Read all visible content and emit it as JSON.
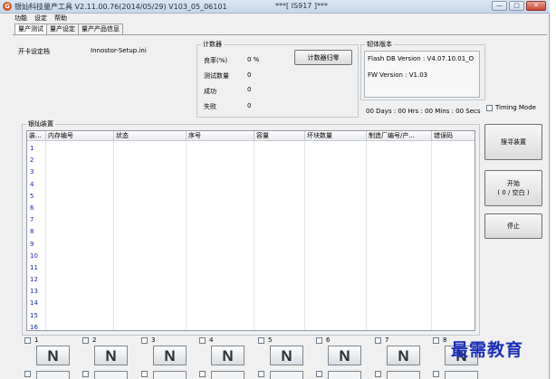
{
  "window": {
    "title": "银灿科技量产工具 V2.11.00.76(2014/05/29)    V103_05_06101",
    "title_mid": "***[ IS917 ]***",
    "icon_name": "app-logo-icon",
    "buttons": [
      "minimize",
      "maximize",
      "close"
    ]
  },
  "menu": [
    "功能",
    "设定",
    "帮助"
  ],
  "tabs": [
    "量产测试",
    "量产设定",
    "量产产品信息"
  ],
  "open_card": {
    "label": "开卡设定档",
    "value": "Innostor-Setup.ini"
  },
  "counter": {
    "legend": "计数器",
    "rows": [
      {
        "label": "良率(%)",
        "value": "0 %"
      },
      {
        "label": "测试数量",
        "value": "0"
      },
      {
        "label": "成功",
        "value": "0"
      },
      {
        "label": "失败",
        "value": "0"
      }
    ],
    "reset_button": "计数器归零"
  },
  "firmware": {
    "legend": "韧体版本",
    "flash_db": "Flash DB Version :  V4.07.10.01_O",
    "fw": "FW Version :   V1.03"
  },
  "elapsed": "00 Days : 00 Hrs : 00 Mins : 00 Secs",
  "timing_mode": {
    "label": "Timing Mode",
    "checked": false
  },
  "device_group": {
    "legend": "银灿装置",
    "columns": [
      "装...",
      "内存编号",
      "状态",
      "序号",
      "容量",
      "坏块数量",
      "制造厂编号/产...",
      "错误码"
    ],
    "rows": [
      "1",
      "2",
      "3",
      "4",
      "5",
      "6",
      "7",
      "8",
      "9",
      "10",
      "11",
      "12",
      "13",
      "14",
      "15",
      "16"
    ]
  },
  "side_buttons": {
    "search": "搜寻装置",
    "start_line1": "开始",
    "start_line2": "( 0 / 空白 )",
    "stop": "停止"
  },
  "slots": [
    {
      "num": "1",
      "label": "N"
    },
    {
      "num": "2",
      "label": "N"
    },
    {
      "num": "3",
      "label": "N"
    },
    {
      "num": "4",
      "label": "N"
    },
    {
      "num": "5",
      "label": "N"
    },
    {
      "num": "6",
      "label": "N"
    },
    {
      "num": "7",
      "label": "N"
    },
    {
      "num": "8",
      "label": "N"
    }
  ],
  "watermark": "最需教育",
  "colors": {
    "row_number": "#1b2aa8",
    "watermark": "#1a2fb8",
    "titlebar": "#c6d6ec"
  }
}
